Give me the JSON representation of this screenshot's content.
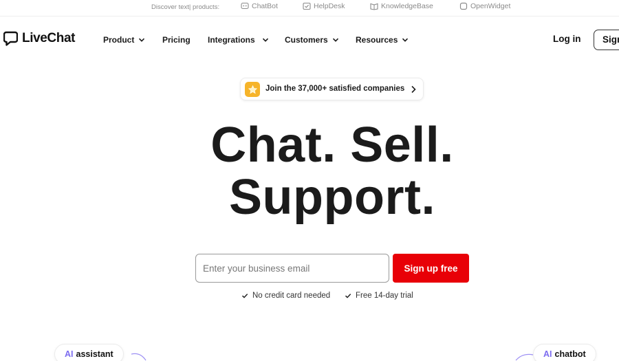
{
  "topbar": {
    "discover_label": "Discover text| products:",
    "products": [
      {
        "label": "ChatBot",
        "icon": "chatbot-icon"
      },
      {
        "label": "HelpDesk",
        "icon": "helpdesk-icon"
      },
      {
        "label": "KnowledgeBase",
        "icon": "knowledgebase-icon"
      },
      {
        "label": "OpenWidget",
        "icon": "openwidget-icon"
      }
    ]
  },
  "nav": {
    "logo_text": "LiveChat",
    "items": [
      {
        "label": "Product",
        "has_dropdown": true
      },
      {
        "label": "Pricing",
        "has_dropdown": false
      },
      {
        "label": "Integrations",
        "has_dropdown": true
      },
      {
        "label": "Customers",
        "has_dropdown": true
      },
      {
        "label": "Resources",
        "has_dropdown": true
      }
    ],
    "login_label": "Log in",
    "signup_label": "Sign up free"
  },
  "badge": {
    "text": "Join the 37,000+ satisfied companies",
    "icon": "star-icon"
  },
  "hero": {
    "line1": "Chat. Sell.",
    "line2": "Support."
  },
  "form": {
    "email_placeholder": "Enter your business email",
    "email_value": "",
    "cta_label": "Sign up free"
  },
  "perks": [
    "No credit card needed",
    "Free 14-day trial"
  ],
  "floating": {
    "left": {
      "prefix": "AI",
      "label": "assistant"
    },
    "right": {
      "prefix": "AI",
      "label": "chatbot"
    }
  },
  "colors": {
    "brand_red": "#e80007",
    "star_yellow": "#f6b42a",
    "ai_purple": "#7c6cf0",
    "text_dark": "#1b1b1b"
  }
}
